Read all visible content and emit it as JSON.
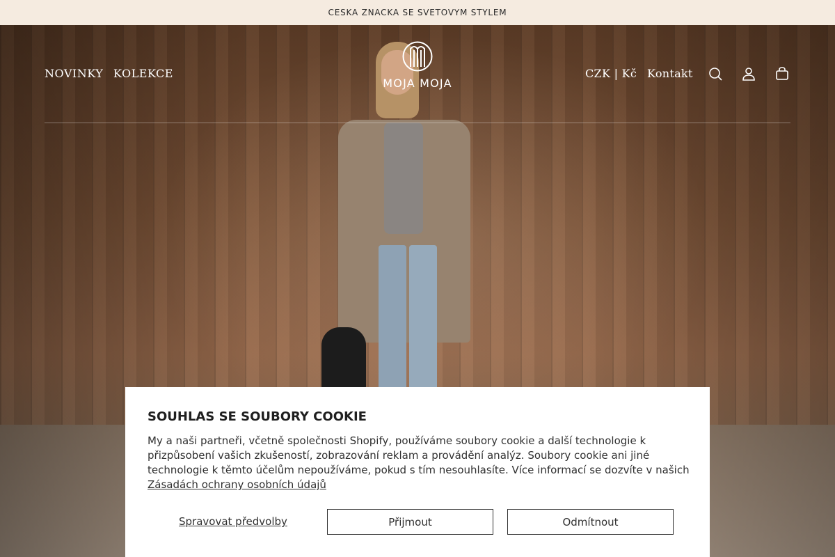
{
  "announcement": {
    "text": "CESKA ZNACKA SE SVETOVYM STYLEM"
  },
  "header": {
    "nav_left": [
      {
        "label": "NOVINKY"
      },
      {
        "label": "KOLEKCE"
      }
    ],
    "logo_text": "MOJA MOJA",
    "currency": "CZK | Kč",
    "contact": "Kontakt",
    "icons": [
      "search-icon",
      "account-icon",
      "cart-icon"
    ]
  },
  "cookie": {
    "title": "SOUHLAS SE SOUBORY COOKIE",
    "body": "My a naši partneři, včetně společnosti Shopify, používáme soubory cookie a další technologie k přizpůsobení vašich zkušeností, zobrazování reklam a provádění analýz. Soubory cookie ani jiné technologie k těmto účelům nepoužíváme, pokud s tím nesouhlasíte. Více informací se dozvíte v našich ",
    "policy_link": "Zásadách ochrany osobních údajů",
    "manage_label": "Spravovat předvolby",
    "accept_label": "Přijmout",
    "decline_label": "Odmítnout"
  },
  "colors": {
    "announcement_bg": "#f5ebe0",
    "header_text": "#ffffff",
    "dialog_bg": "#ffffff",
    "dialog_text": "#303030"
  }
}
